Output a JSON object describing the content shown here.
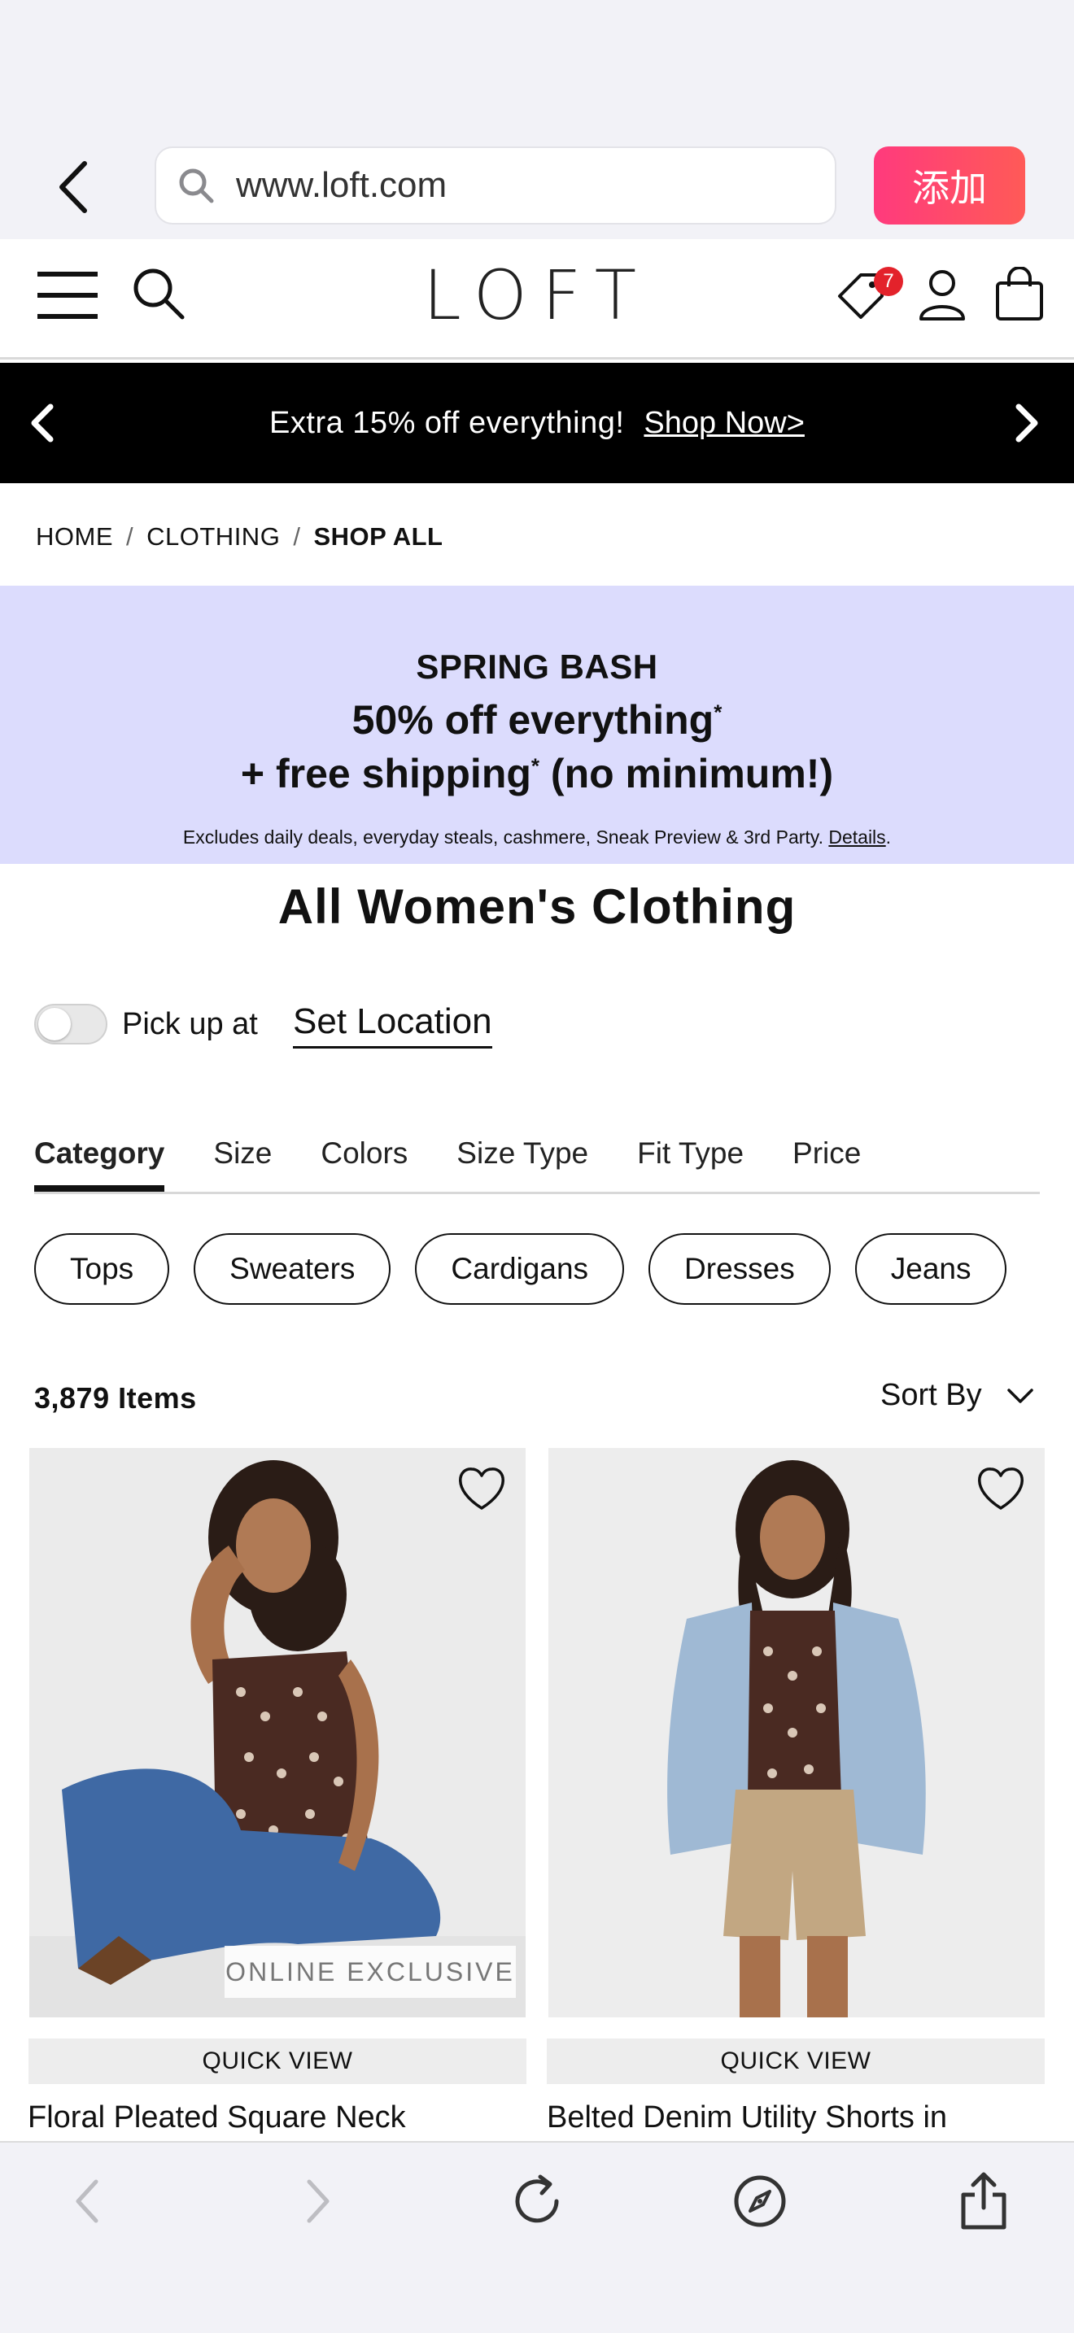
{
  "browser": {
    "url": "www.loft.com",
    "add_label": "添加"
  },
  "header": {
    "logo": "LOFT",
    "promo_badge_count": "7"
  },
  "promo_bar": {
    "text": "Extra 15% off everything!",
    "link": "Shop Now>"
  },
  "breadcrumb": {
    "items": [
      "HOME",
      "CLOTHING",
      "SHOP ALL"
    ],
    "separator": "/"
  },
  "sale_banner": {
    "title": "SPRING BASH",
    "line1": "50% off everything",
    "line2_a": "+ free shipping",
    "line2_b": " (no minimum!)",
    "asterisk": "*",
    "fine_print": "Excludes daily deals, everyday steals, cashmere, Sneak Preview & 3rd Party.",
    "details_link": "Details",
    "background": "#dcdcfd"
  },
  "page": {
    "title": "All Women's Clothing"
  },
  "pickup": {
    "label": "Pick up at",
    "link": "Set Location",
    "enabled": false
  },
  "filters": {
    "tabs": [
      "Category",
      "Size",
      "Colors",
      "Size Type",
      "Fit Type",
      "Price"
    ],
    "active": "Category",
    "chips": [
      "Tops",
      "Sweaters",
      "Cardigans",
      "Dresses",
      "Jeans"
    ]
  },
  "results": {
    "count": "3,879 Items",
    "sort_label": "Sort By"
  },
  "products": [
    {
      "name": "Floral Pleated Square Neck",
      "badge": "ONLINE EXCLUSIVE",
      "quick_view": "QUICK VIEW"
    },
    {
      "name": "Belted Denim Utility Shorts in",
      "quick_view": "QUICK VIEW"
    }
  ],
  "icons": {
    "back": "chevron-left-icon",
    "search": "search-icon",
    "menu": "hamburger-menu-icon",
    "tag": "price-tag-icon",
    "account": "user-icon",
    "bag": "shopping-bag-icon",
    "heart": "heart-icon",
    "reload": "reload-icon",
    "safari": "compass-icon",
    "share": "share-icon"
  },
  "colors": {
    "promo_bar": "#000000",
    "badge": "#e3222b",
    "add_button_from": "#ff3a7d",
    "add_button_to": "#ff5a57"
  }
}
